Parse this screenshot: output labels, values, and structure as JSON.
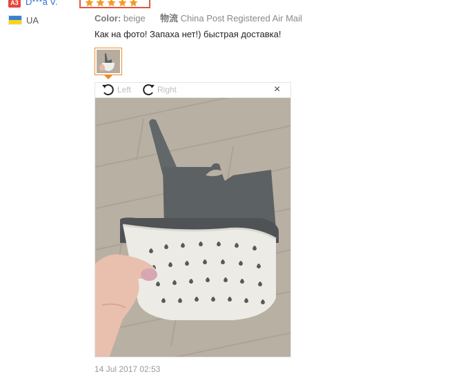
{
  "user": {
    "level": "A3",
    "name": "D***a V.",
    "country": "UA"
  },
  "review": {
    "stars": 5,
    "color_label": "Color:",
    "color_value": "beige",
    "shipping_label": "物流",
    "shipping_value": "China Post Registered Air Mail",
    "comment": "Как на фото! Запаха нет!) быстрая доставка!",
    "date": "14 Jul 2017 02:53"
  },
  "viewer": {
    "rotate_left": "Left",
    "rotate_right": "Right",
    "close": "×"
  },
  "colors": {
    "star": "#f39c24",
    "accent": "#e0563f",
    "thumb_border": "#f08a24",
    "link": "#2a6ecf"
  },
  "icons": [
    "rotate-left-icon",
    "rotate-right-icon",
    "close-icon",
    "star-icon",
    "flag-icon"
  ]
}
